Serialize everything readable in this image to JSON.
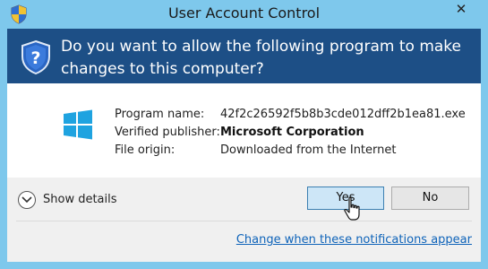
{
  "window": {
    "title": "User Account Control",
    "close_label": "✕"
  },
  "header": {
    "question": "Do you want to allow the following program to make changes to this computer?"
  },
  "program_info": {
    "rows": [
      {
        "label": "Program name:",
        "value": "42f2c26592f5b8b3cde012dff2b1ea81.exe"
      },
      {
        "label": "Verified publisher:",
        "value": "Microsoft Corporation"
      },
      {
        "label": "File origin:",
        "value": "Downloaded from the Internet"
      }
    ]
  },
  "footer": {
    "show_details_label": "Show details",
    "yes_label": "Yes",
    "no_label": "No",
    "notifications_link": "Change when these notifications appear"
  },
  "colors": {
    "title_bar": "#7ec8ec",
    "header_band": "#1d4f86",
    "link": "#0e63b9",
    "windows_logo": "#1fa3e0"
  },
  "icons": [
    "uac-shield-icon",
    "windows-logo-icon",
    "chevron-down-icon",
    "close-icon",
    "mouse-cursor-icon"
  ]
}
